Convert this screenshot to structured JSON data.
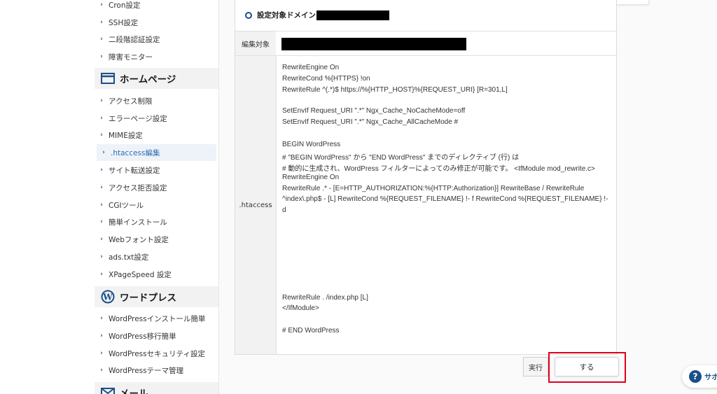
{
  "sidebar": {
    "server_items": [
      {
        "label": "Cron設定"
      },
      {
        "label": "SSH設定"
      },
      {
        "label": "二段階認証設定"
      },
      {
        "label": "障害モニター"
      }
    ],
    "homepage_heading": "ホームページ",
    "homepage_items": [
      {
        "label": "アクセス制限"
      },
      {
        "label": "エラーページ設定"
      },
      {
        "label": "MIME設定"
      },
      {
        "label": ".htaccess編集"
      },
      {
        "label": "サイト転送設定"
      },
      {
        "label": "アクセス拒否設定"
      },
      {
        "label": "CGIツール"
      },
      {
        "label": "簡単インストール"
      },
      {
        "label": "Webフォント設定"
      },
      {
        "label": "ads.txt設定"
      },
      {
        "label": "XPageSpeed 設定"
      }
    ],
    "wordpress_heading": "ワードプレス",
    "wordpress_items": [
      {
        "label": "WordPressインストール簡単"
      },
      {
        "label": "WordPress移行簡単"
      },
      {
        "label": "WordPressセキュリティ設定"
      },
      {
        "label": "WordPressテーマ管理"
      }
    ],
    "mail_heading": "メール"
  },
  "main": {
    "domain_title": "設定対象ドメイン",
    "edit_target_label": "編集対象",
    "htaccess_label": ".htaccess",
    "htaccess_lines": [
      "RewriteEngine On",
      "RewriteCond %{HTTPS} !on",
      "RewriteRule ^(.*)$ https://%{HTTP_HOST}%{REQUEST_URI} [R=301,L]",
      "SetEnvIf Request_URI \".*\" Ngx_Cache_NoCacheMode=off",
      "SetEnvIf Request_URI \".*\" Ngx_Cache_AllCacheMode #",
      "BEGIN WordPress",
      "# \"BEGIN WordPress\" から \"END WordPress\" までのディレクティブ (行) は",
      "# 動的に生成され、WordPress フィルターによってのみ修正が可能です。 <IfModule mod_rewrite.c>",
      "RewriteEngine On",
      "RewriteRule .* - [E=HTTP_AUTHORIZATION:%{HTTP:Authorization}] RewriteBase / RewriteRule",
      "^index\\.php$ - [L] RewriteCond %{REQUEST_FILENAME} !- f RewriteCond %{REQUEST_FILENAME} !-",
      "d",
      "RewriteRule . /index.php [L]",
      "</IfModule>",
      "# END WordPress"
    ],
    "exec_button": "実行",
    "do_button": "する"
  },
  "support": {
    "label": "サポ"
  }
}
